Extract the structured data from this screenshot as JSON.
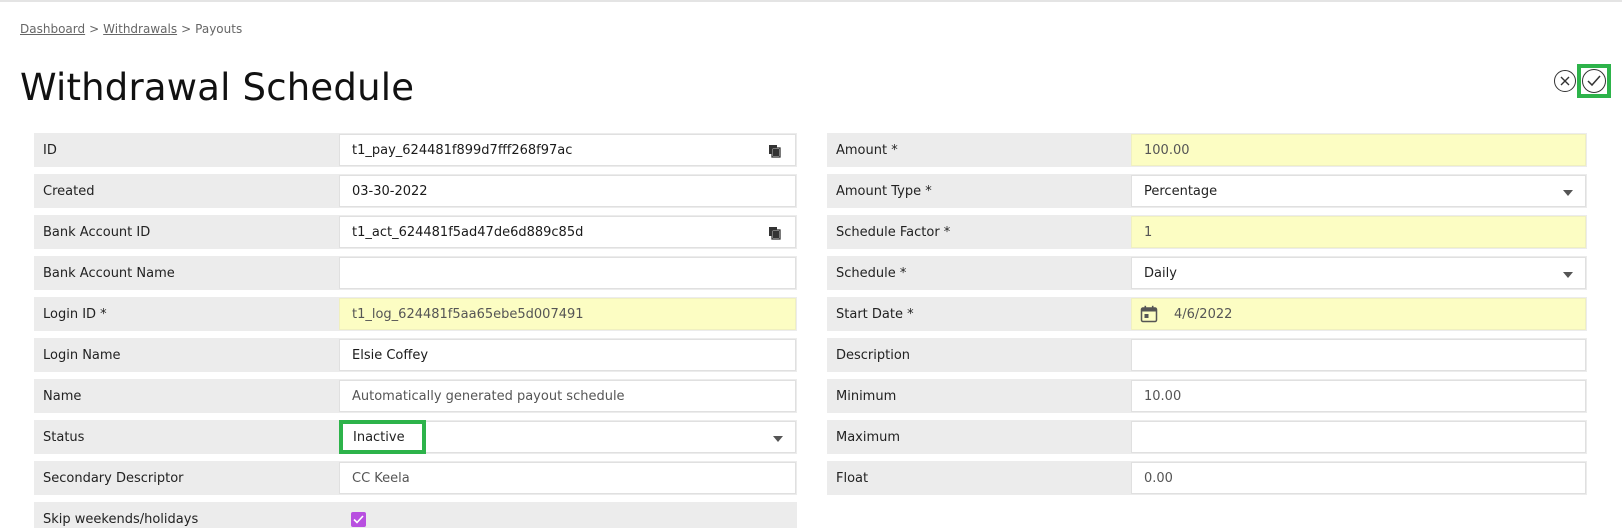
{
  "breadcrumb": {
    "items": [
      "Dashboard",
      "Withdrawals",
      "Payouts"
    ],
    "separator": ">"
  },
  "page_title": "Withdrawal Schedule",
  "actions": {
    "close_icon": "close-circle-icon",
    "confirm_icon": "check-circle-icon"
  },
  "left_fields": {
    "id": {
      "label": "ID",
      "value": "t1_pay_624481f899d7fff268f97ac"
    },
    "created": {
      "label": "Created",
      "value": "03-30-2022"
    },
    "bank_account_id": {
      "label": "Bank Account ID",
      "value": "t1_act_624481f5ad47de6d889c85d"
    },
    "bank_account_name": {
      "label": "Bank Account Name",
      "value": ""
    },
    "login_id": {
      "label": "Login ID *",
      "value": "t1_log_624481f5aa65ebe5d007491"
    },
    "login_name": {
      "label": "Login Name",
      "value": "Elsie Coffey"
    },
    "name": {
      "label": "Name",
      "value": "Automatically generated payout schedule"
    },
    "status": {
      "label": "Status",
      "value": "Inactive"
    },
    "secondary_descriptor": {
      "label": "Secondary Descriptor",
      "value": "CC Keela"
    },
    "skip_weekends": {
      "label": "Skip weekends/holidays",
      "checked": true
    }
  },
  "right_fields": {
    "amount": {
      "label": "Amount *",
      "value": "100.00"
    },
    "amount_type": {
      "label": "Amount Type *",
      "value": "Percentage"
    },
    "schedule_factor": {
      "label": "Schedule Factor *",
      "value": "1"
    },
    "schedule": {
      "label": "Schedule *",
      "value": "Daily"
    },
    "start_date": {
      "label": "Start Date *",
      "value": "4/6/2022"
    },
    "description": {
      "label": "Description",
      "value": ""
    },
    "minimum": {
      "label": "Minimum",
      "value": "10.00"
    },
    "maximum": {
      "label": "Maximum",
      "value": ""
    },
    "float": {
      "label": "Float",
      "value": "0.00"
    }
  },
  "colors": {
    "highlight": "#2db34a",
    "required_field_bg": "#fcfdc3",
    "checkbox": "#b84fe0",
    "label_bg": "#ececec"
  }
}
